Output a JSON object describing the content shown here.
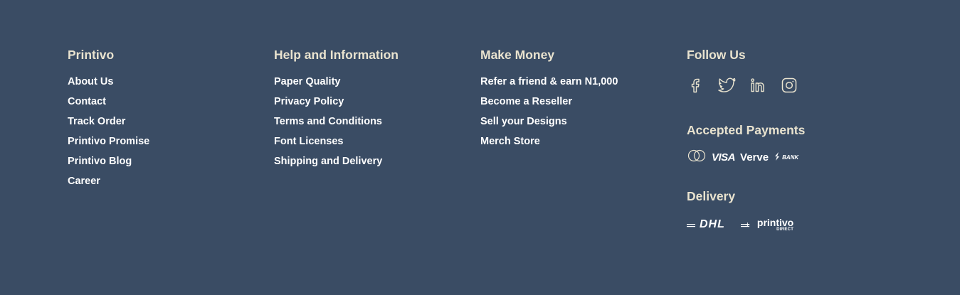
{
  "columns": [
    {
      "heading": "Printivo",
      "links": [
        "About Us",
        "Contact",
        "Track Order",
        "Printivo Promise",
        "Printivo Blog",
        "Career"
      ]
    },
    {
      "heading": "Help and Information",
      "links": [
        "Paper Quality",
        "Privacy Policy",
        "Terms and Conditions",
        "Font Licenses",
        "Shipping and Delivery"
      ]
    },
    {
      "heading": "Make Money",
      "links": [
        "Refer a friend & earn N1,000",
        "Become a Reseller",
        "Sell your Designs",
        "Merch Store"
      ]
    }
  ],
  "follow": {
    "heading": "Follow Us",
    "icons": [
      "facebook-icon",
      "twitter-icon",
      "linkedin-icon",
      "instagram-icon"
    ]
  },
  "payments": {
    "heading": "Accepted Payments",
    "visa": "VISA",
    "verve": "Verve",
    "bank": "BANK"
  },
  "delivery": {
    "heading": "Delivery",
    "dhl": "DHL",
    "plus": "+",
    "printivo": "printivo",
    "direct": "DIRECT"
  },
  "colors": {
    "background": "#3a4c64",
    "heading": "#e9e3cf",
    "link": "#ffffff"
  }
}
